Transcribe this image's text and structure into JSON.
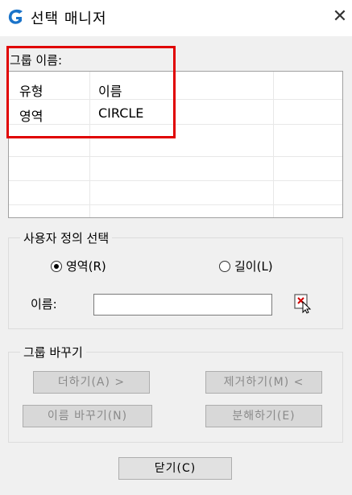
{
  "window": {
    "title": "선택 매니저",
    "close_symbol": "✕",
    "icon": "gstarcad-app-icon"
  },
  "group_name_label": "그룹 이름:",
  "table": {
    "columns": [
      "유형",
      "이름"
    ],
    "rows": [
      [
        "영역",
        "CIRCLE"
      ]
    ]
  },
  "custom_selection": {
    "title": "사용자 정의 선택",
    "options": [
      {
        "label": "영역(R)",
        "selected": true
      },
      {
        "label": "길이(L)",
        "selected": false
      }
    ],
    "name_label": "이름:",
    "name_value": "",
    "select_icon": "select-objects-icon"
  },
  "group_change": {
    "title": "그룹 바꾸기",
    "buttons": {
      "add": "더하기(A) >",
      "remove": "제거하기(M) <",
      "rename": "이름 바꾸기(N)",
      "explode": "분해하기(E)"
    }
  },
  "close_button": "닫기(C)",
  "colors": {
    "highlight": "#e00000",
    "app_icon": "#1a73c9"
  }
}
